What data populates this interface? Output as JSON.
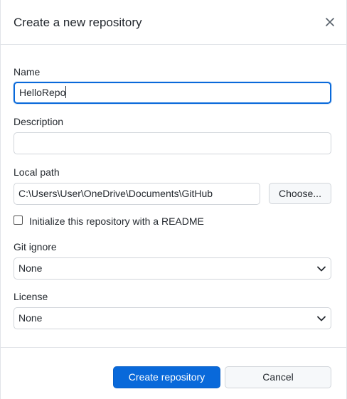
{
  "dialog": {
    "title": "Create a new repository"
  },
  "icons": {
    "close": "close-icon",
    "chevron": "chevron-down-icon"
  },
  "form": {
    "name_label": "Name",
    "name_value": "HelloRepo",
    "description_label": "Description",
    "description_value": "",
    "local_path_label": "Local path",
    "local_path_value": "C:\\Users\\User\\OneDrive\\Documents\\GitHub",
    "choose_label": "Choose...",
    "readme_label": "Initialize this repository with a README",
    "readme_checked": false,
    "gitignore_label": "Git ignore",
    "gitignore_value": "None",
    "license_label": "License",
    "license_value": "None"
  },
  "footer": {
    "create_label": "Create repository",
    "cancel_label": "Cancel"
  },
  "colors": {
    "accent": "#0969da",
    "border": "#d1d5da",
    "divider": "#e1e4e8"
  }
}
